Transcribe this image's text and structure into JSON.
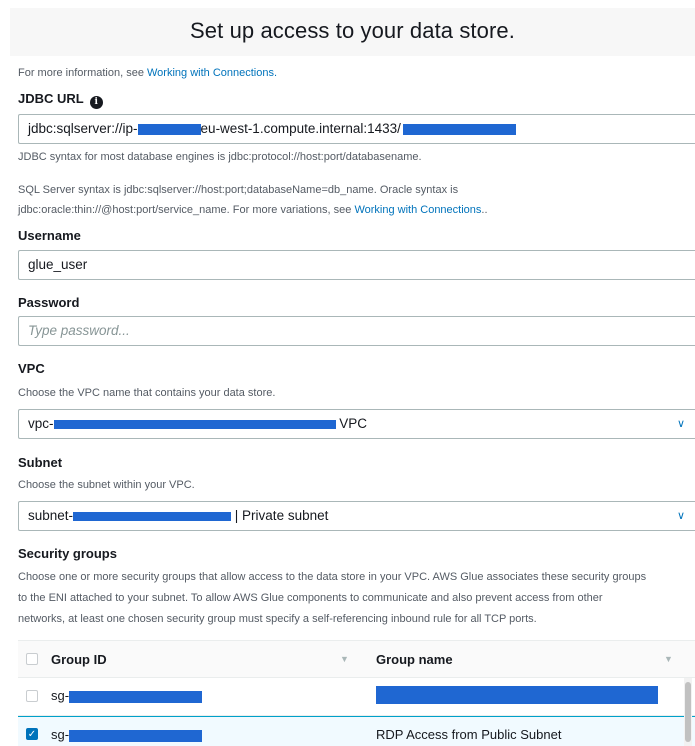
{
  "title": "Set up access to your data store.",
  "info_line": {
    "prefix": "For more information, see ",
    "link": "Working with Connections."
  },
  "jdbc": {
    "label": "JDBC URL",
    "value_part1": "jdbc:sqlserver://ip-",
    "value_part2": "eu-west-1.compute.internal:1433/",
    "help1": "JDBC syntax for most database engines is jdbc:protocol://host:port/databasename.",
    "help2_line1": "SQL Server syntax is jdbc:sqlserver://host:port;databaseName=db_name. Oracle syntax is",
    "help2_line2_prefix": "jdbc:oracle:thin://@host:port/service_name. For more variations, see ",
    "help2_link": "Working with Connections",
    "help2_suffix": ".."
  },
  "username": {
    "label": "Username",
    "value": "glue_user"
  },
  "password": {
    "label": "Password",
    "placeholder": "Type password..."
  },
  "vpc": {
    "label": "VPC",
    "help": "Choose the VPC name that contains your data store.",
    "value_prefix": "vpc-",
    "value_suffix": "VPC"
  },
  "subnet": {
    "label": "Subnet",
    "help": "Choose the subnet within your VPC.",
    "value_prefix": "subnet-",
    "value_suffix": "| Private subnet"
  },
  "security_groups": {
    "label": "Security groups",
    "help_line1": "Choose one or more security groups that allow access to the data store in your VPC. AWS Glue associates these security groups",
    "help_line2": "to the ENI attached to your subnet. To allow AWS Glue components to communicate and also prevent access from other",
    "help_line3": "networks, at least one chosen security group must specify a self-referencing inbound rule for all TCP ports.",
    "columns": [
      "Group ID",
      "Group name"
    ],
    "rows": [
      {
        "id_prefix": "sg-",
        "name": "",
        "checked": false
      },
      {
        "id_prefix": "sg-",
        "name": "RDP Access from Public Subnet",
        "checked": true
      }
    ]
  },
  "colors": {
    "link": "#0073bb",
    "redaction": "#1f67d2",
    "selected_row": "#f1faff"
  },
  "icons": [
    "info-icon",
    "chevron-down-icon",
    "sort-icon",
    "checkbox-icon"
  ]
}
